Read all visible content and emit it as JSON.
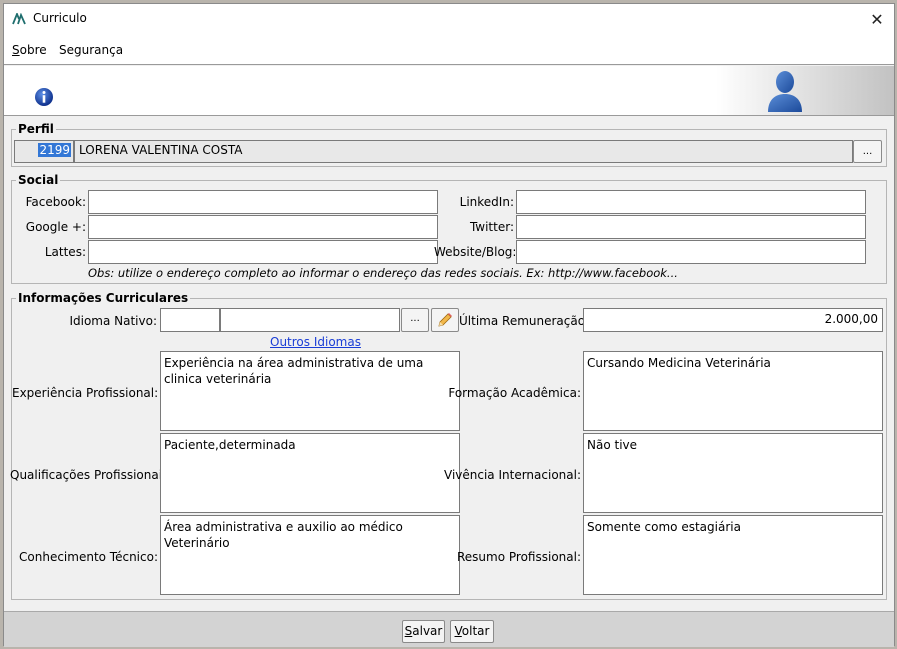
{
  "window": {
    "title": "Curriculo",
    "close_glyph": "✕"
  },
  "menu": {
    "items": [
      {
        "label_first": "S",
        "label_rest": "obre"
      },
      {
        "label": "Segurança"
      }
    ]
  },
  "header": {
    "left_icon": "info-icon",
    "right_icon": "user-silhouette-icon"
  },
  "perfil": {
    "legend": "Perfil",
    "id": "2199",
    "name": "LORENA VALENTINA COSTA",
    "browse_label": "..."
  },
  "social": {
    "legend": "Social",
    "facebook_label": "Facebook:",
    "facebook_value": "",
    "linkedin_label": "LinkedIn:",
    "linkedin_value": "",
    "google_label": "Google +:",
    "google_value": "",
    "twitter_label": "Twitter:",
    "twitter_value": "",
    "lattes_label": "Lattes:",
    "lattes_value": "",
    "website_label": "Website/Blog:",
    "website_value": "",
    "obs": "Obs: utilize o endereço completo ao informar o endereço das redes sociais. Ex: http://www.facebook..."
  },
  "curriculares": {
    "legend": "Informações Curriculares",
    "idioma_label": "Idioma Nativo:",
    "idioma_code": "",
    "idioma_name": "",
    "idioma_browse": "...",
    "idioma_edit_icon": "pencil-icon",
    "ultima_label": "Última Remuneração:",
    "ultima_value": "2.000,00",
    "outros_idiomas": "Outros Idiomas",
    "experiencia_label": "Experiência Profissional:",
    "experiencia_value": "Experiência na área administrativa de uma clinica veterinária",
    "formacao_label": "Formação Acadêmica:",
    "formacao_value": "Cursando Medicina Veterinária",
    "qualificacoes_label": "Qualificações Profissionais:",
    "qualificacoes_value": "Paciente,determinada",
    "vivencia_label": "Vivência Internacional:",
    "vivencia_value": "Não tive",
    "conhecimento_label": "Conhecimento Técnico:",
    "conhecimento_value": "Área administrativa e auxilio ao médico Veterinário",
    "resumo_label": "Resumo Profissional:",
    "resumo_value": "Somente como estagiária"
  },
  "footer": {
    "salvar_first": "S",
    "salvar_rest": "alvar",
    "voltar_first": "V",
    "voltar_rest": "oltar"
  }
}
